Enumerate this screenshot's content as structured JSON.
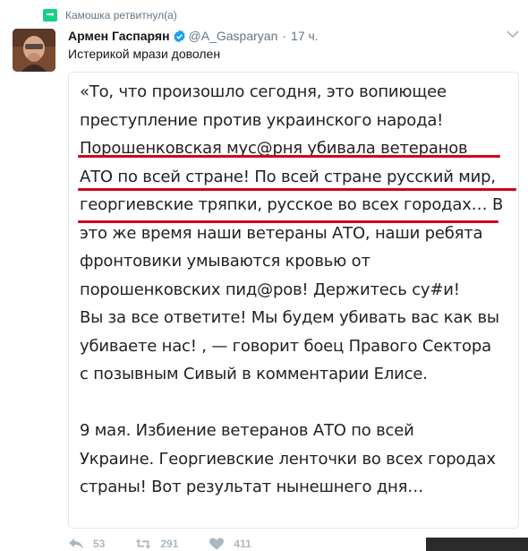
{
  "retweet": {
    "text": "Камошка ретвитнул(а)",
    "icon": "retweet-icon",
    "color": "#19cf86"
  },
  "tweet": {
    "fullname": "Армен Гаспарян",
    "verified_icon": "verified-badge-icon",
    "handle": "@A_Gasparyan",
    "separator": "·",
    "time": "17 ч.",
    "text": "Истерикой мрази доволен",
    "avatar_icon": "avatar"
  },
  "media": {
    "lines": [
      "«То, что произошло сегодня, это вопиющее",
      "преступление против украинского народа!",
      "Порошенковская  мус@рня убивала ветеранов",
      "АТО по всей стране! По всей стране русский мир,",
      "георгиевские тряпки, русское во всех городах… В",
      "это же время наши ветераны АТО, наши ребята",
      "фронтовики умываются кровью от",
      "порошенковских  пид@ров! Держитесь су#и!",
      "Вы за все ответите! Мы будем убивать вас как вы",
      "убиваете нас!  , — говорит боец Правого Сектора",
      "с позывным Сивый в комментарии Елисе.",
      "",
      "9 мая. Избиение ветеранов АТО по всей",
      "Украине. Георгиевские ленточки во всех городах",
      "страны! Вот результат нынешнего дня…"
    ],
    "underline_color": "#d0021b"
  },
  "actions": {
    "reply_count": "53",
    "retweet_count": "291",
    "like_count": "411",
    "icon_color": "#aab8c2"
  }
}
